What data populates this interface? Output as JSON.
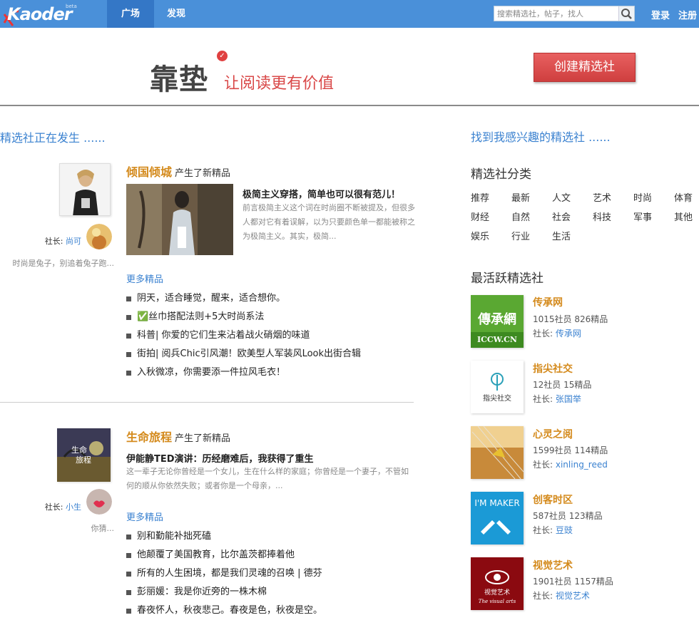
{
  "nav": {
    "logo_text": "Kaoder",
    "logo_badge": "beta",
    "tabs": [
      {
        "label": "广场"
      },
      {
        "label": "发现"
      }
    ],
    "search_placeholder": "搜索精选社，帖子，找人",
    "login": "登录",
    "register": "注册"
  },
  "banner": {
    "slogan_main": "靠垫",
    "slogan_sub": "让阅读更有价值",
    "create_button": "创建精选社"
  },
  "feed": {
    "heading": "精选社正在发生 ......",
    "events": [
      {
        "club": "倾国倾城",
        "action": "产生了新精品",
        "owner_prefix": "社长:",
        "owner": "尚可",
        "owner_bio": "时尚是兔子，别追着兔子跑...",
        "article_title": "极简主义穿搭，简单也可以很有范儿！",
        "article_excerpt": "前言极简主义这个词在时尚圈不断被提及，但很多人都对它有着误解，以为只要颜色单一都能被称之为极简主义。其实，极简...",
        "more": "更多精品",
        "posts": [
          "阴天，适合睡觉，醒来，适合想你。",
          "✅丝巾搭配法则+5大时尚系法",
          "科普| 你爱的它们生来沾着战火硝烟的味道",
          "街拍| 阅兵Chic引风潮！欧美型人军装风Look出街合辑",
          "入秋微凉，你需要添一件拉风毛衣！"
        ]
      },
      {
        "club": "生命旅程",
        "action": "产生了新精品",
        "owner_prefix": "社长:",
        "owner": "小生",
        "owner_bio": "你猜...",
        "article_title": "伊能静TED演讲：历经磨难后，我获得了重生",
        "article_excerpt": "这一辈子无论你曾经是一个女儿，生在什么样的家庭；你曾经是一个妻子，不管如何的顺从你依然失败；或者你是一个母亲，...",
        "more": "更多精品",
        "posts": [
          "别和勤能补拙死磕",
          "他颠覆了美国教育，比尔盖茨都捧着他",
          "所有的人生困境，都是我们灵魂的召唤 | 德芬",
          "彭丽媛：我是你近旁的一株木棉",
          "春夜怀人，秋夜悲己。春夜是色，秋夜是空。"
        ]
      }
    ]
  },
  "sidebar": {
    "heading": "找到我感兴趣的精选社 ......",
    "categories_heading": "精选社分类",
    "categories": [
      "推荐",
      "最新",
      "人文",
      "艺术",
      "时尚",
      "体育",
      "财经",
      "自然",
      "社会",
      "科技",
      "军事",
      "其他",
      "娱乐",
      "行业",
      "生活"
    ],
    "active_heading": "最活跃精选社",
    "clubs": [
      {
        "name": "传承网",
        "stats": "1015社员  826精品",
        "owner_prefix": "社长:",
        "owner": "传承网",
        "logo_text": "傳承網",
        "logo_sub": "ICCW.CN"
      },
      {
        "name": "指尖社交",
        "stats": "12社员  15精品",
        "owner_prefix": "社长:",
        "owner": "张国举",
        "logo_text": "指尖社交"
      },
      {
        "name": "心灵之阅",
        "stats": "1599社员  114精品",
        "owner_prefix": "社长:",
        "owner": "xinling_reed"
      },
      {
        "name": "创客时区",
        "stats": "587社员  123精品",
        "owner_prefix": "社长:",
        "owner": "豆豉",
        "logo_text": "I'M MAKER"
      },
      {
        "name": "视觉艺术",
        "stats": "1901社员  1157精品",
        "owner_prefix": "社长:",
        "owner": "视觉艺术",
        "logo_text": "视觉艺术",
        "logo_sub": "The visual arts"
      }
    ]
  },
  "colors": {
    "nav_bg": "#4a90d9",
    "accent_orange": "#d48a1c",
    "link_blue": "#3b82d0",
    "create_red": "#d94848"
  }
}
